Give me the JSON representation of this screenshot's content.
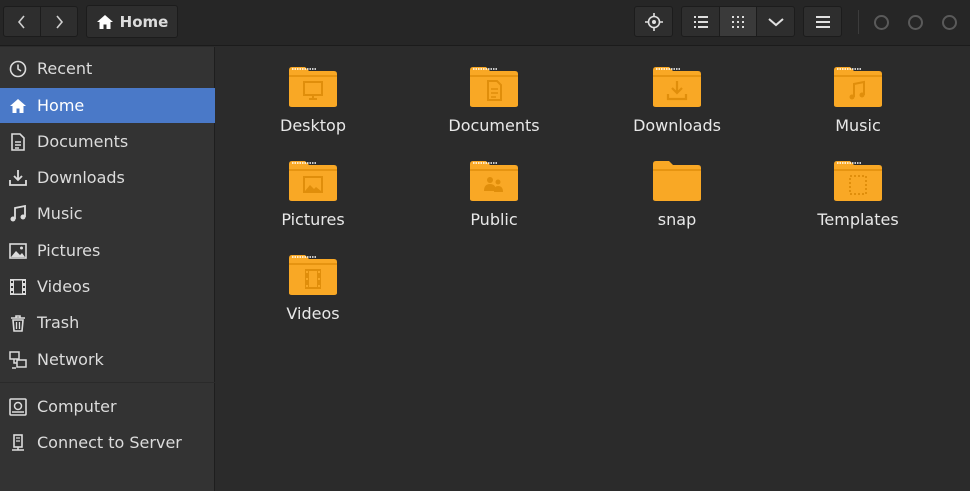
{
  "header": {
    "back_icon": "chevron-left-icon",
    "forward_icon": "chevron-right-icon",
    "path_label": "Home",
    "path_icon": "home-icon",
    "locate_icon": "crosshair-icon",
    "list_view_icon": "list-view-icon",
    "grid_view_icon": "grid-view-icon",
    "view_options_icon": "chevron-down-icon",
    "menu_icon": "hamburger-menu-icon"
  },
  "sidebar": {
    "items": [
      {
        "label": "Recent",
        "icon": "clock-icon"
      },
      {
        "label": "Home",
        "icon": "home-icon",
        "active": true
      },
      {
        "label": "Documents",
        "icon": "document-icon"
      },
      {
        "label": "Downloads",
        "icon": "download-icon"
      },
      {
        "label": "Music",
        "icon": "music-icon"
      },
      {
        "label": "Pictures",
        "icon": "picture-icon"
      },
      {
        "label": "Videos",
        "icon": "film-icon"
      },
      {
        "label": "Trash",
        "icon": "trash-icon"
      },
      {
        "label": "Network",
        "icon": "network-icon"
      },
      {
        "label": "Computer",
        "icon": "computer-icon"
      },
      {
        "label": "Connect to Server",
        "icon": "server-icon"
      }
    ]
  },
  "folders": [
    {
      "label": "Desktop",
      "emblem": "desktop-emblem"
    },
    {
      "label": "Documents",
      "emblem": "document-emblem"
    },
    {
      "label": "Downloads",
      "emblem": "download-emblem"
    },
    {
      "label": "Music",
      "emblem": "music-emblem"
    },
    {
      "label": "Pictures",
      "emblem": "picture-emblem"
    },
    {
      "label": "Public",
      "emblem": "people-emblem"
    },
    {
      "label": "snap",
      "emblem": "none"
    },
    {
      "label": "Templates",
      "emblem": "template-emblem"
    },
    {
      "label": "Videos",
      "emblem": "film-emblem"
    }
  ],
  "colors": {
    "accent": "#4a79c8",
    "folder": "#f9a825",
    "folder_dark": "#e08e0b"
  }
}
